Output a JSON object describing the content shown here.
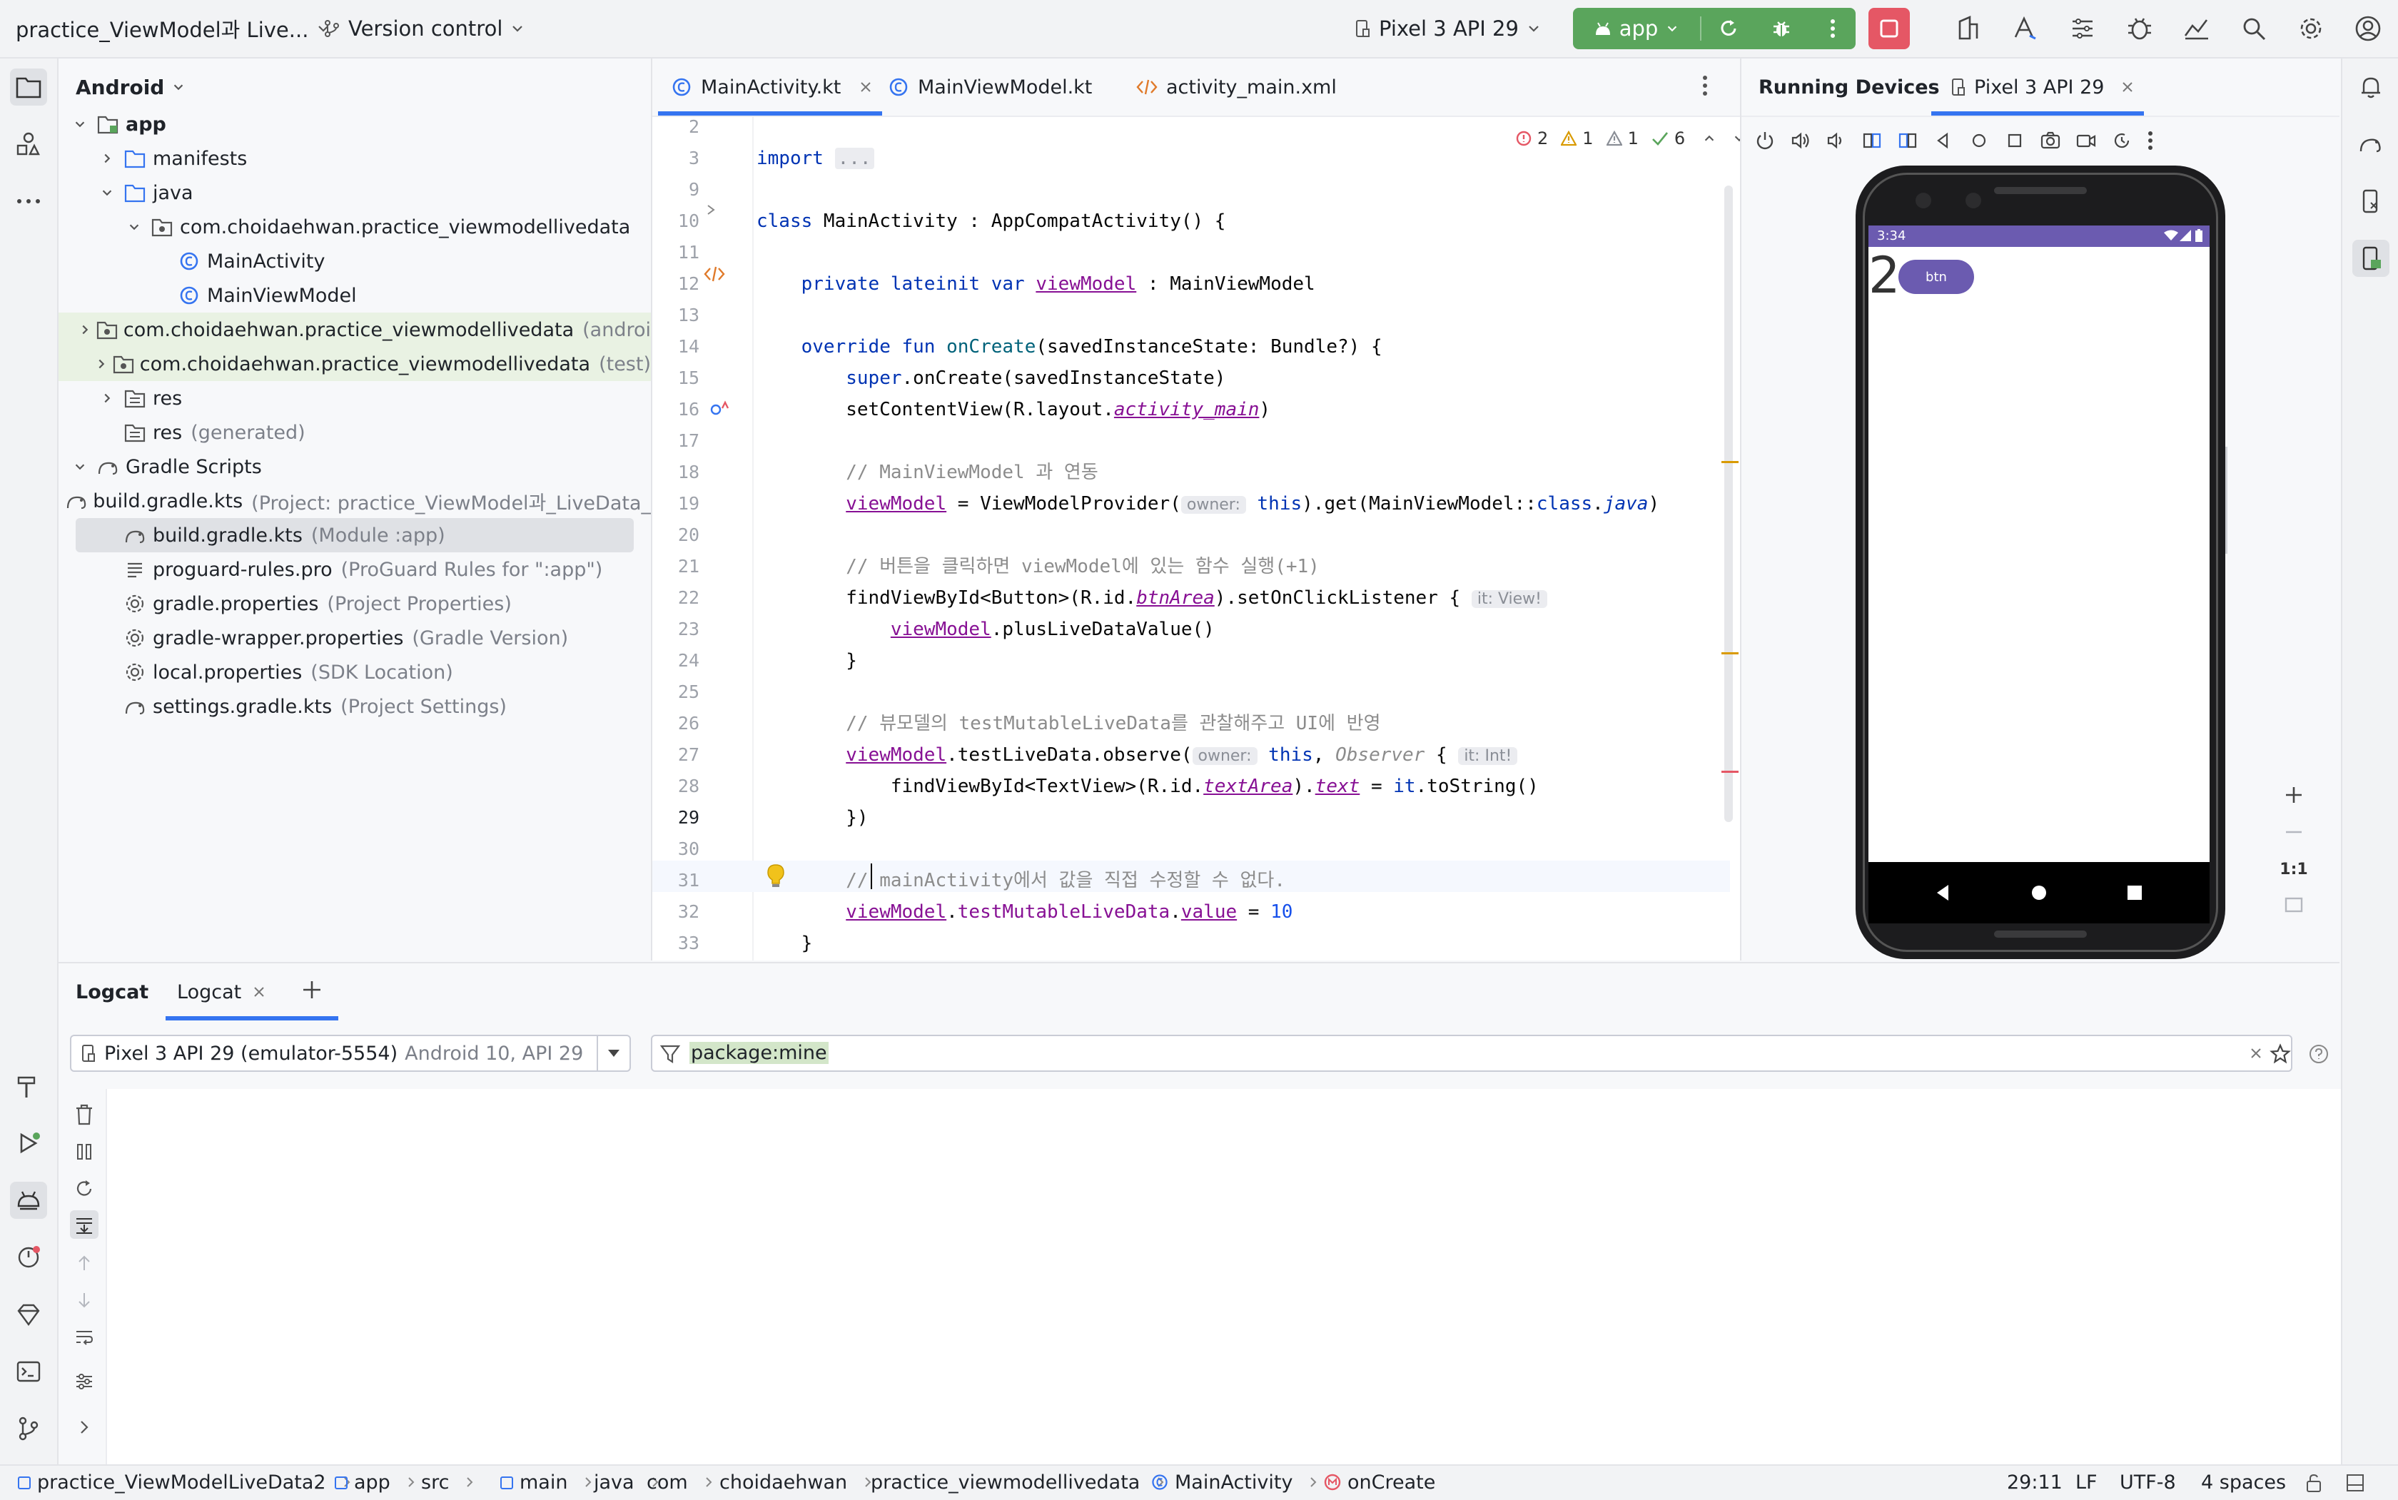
{
  "titlebar": {
    "project_name": "practice_ViewModel과 Live...",
    "vcs_label": "Version control",
    "device_label": "Pixel 3 API 29",
    "run_config": "app"
  },
  "project_panel": {
    "view_mode": "Android",
    "items": [
      {
        "label": "app",
        "hint": ""
      },
      {
        "label": "manifests",
        "hint": ""
      },
      {
        "label": "java",
        "hint": ""
      },
      {
        "label": "com.choidaehwan.practice_viewmodellivedata",
        "hint": ""
      },
      {
        "label": "MainActivity",
        "hint": ""
      },
      {
        "label": "MainViewModel",
        "hint": ""
      },
      {
        "label": "com.choidaehwan.practice_viewmodellivedata",
        "hint": "(androi"
      },
      {
        "label": "com.choidaehwan.practice_viewmodellivedata",
        "hint": "(test)"
      },
      {
        "label": "res",
        "hint": ""
      },
      {
        "label": "res",
        "hint": "(generated)"
      },
      {
        "label": "Gradle Scripts",
        "hint": ""
      },
      {
        "label": "build.gradle.kts",
        "hint": "(Project: practice_ViewModel과_LiveData_"
      },
      {
        "label": "build.gradle.kts",
        "hint": "(Module :app)"
      },
      {
        "label": "proguard-rules.pro",
        "hint": "(ProGuard Rules for \":app\")"
      },
      {
        "label": "gradle.properties",
        "hint": "(Project Properties)"
      },
      {
        "label": "gradle-wrapper.properties",
        "hint": "(Gradle Version)"
      },
      {
        "label": "local.properties",
        "hint": "(SDK Location)"
      },
      {
        "label": "settings.gradle.kts",
        "hint": "(Project Settings)"
      }
    ]
  },
  "editor": {
    "tabs": [
      "MainActivity.kt",
      "MainViewModel.kt",
      "activity_main.xml"
    ],
    "inspections": {
      "errors": "2",
      "warnings": "1",
      "weak_warnings": "1",
      "ok": "6"
    },
    "line_numbers": [
      "2",
      "3",
      "9",
      "10",
      "11",
      "12",
      "13",
      "14",
      "15",
      "16",
      "17",
      "18",
      "19",
      "20",
      "21",
      "22",
      "23",
      "24",
      "25",
      "26",
      "27",
      "28",
      "29",
      "30",
      "31",
      "32",
      "33"
    ],
    "code": {
      "l3_import": "import",
      "l3_fold": "...",
      "l10_class": "class",
      "l10_name": "MainActivity",
      "l10_rest": " : AppCompatActivity() {",
      "l12_mods": "private lateinit var",
      "l12_prop": "viewModel",
      "l12_type": " : MainViewModel",
      "l14_mods": "override fun",
      "l14_fn": "onCreate",
      "l14_rest": "(savedInstanceState: Bundle?) {",
      "l15_super": "super",
      "l15_rest": ".onCreate(savedInstanceState)",
      "l16_a": "setContentView(R.layout.",
      "l16_b": "activity_main",
      "l16_c": ")",
      "l18_comment": "// MainViewModel 과 연동",
      "l19_prop": "viewModel",
      "l19_a": " = ViewModelProvider(",
      "l19_hint": "owner:",
      "l19_this": "this",
      "l19_b": ").get(MainViewModel::",
      "l19_class": "class",
      "l19_dot": ".",
      "l19_java": "java",
      "l19_c": ")",
      "l21_comment": "// 버튼을 클릭하면 viewModel에 있는 함수 실행(+1)",
      "l22_a": "findViewById<Button>(R.id.",
      "l22_id": "btnArea",
      "l22_b": ").setOnClickListener {",
      "l22_hint": "it: View!",
      "l23_prop": "viewModel",
      "l23_rest": ".plusLiveDataValue()",
      "l24": "}",
      "l26_comment": "// 뷰모델의 testMutableLiveData를 관찰해주고 UI에 반영",
      "l27_prop": "viewModel",
      "l27_a": ".testLiveData.observe(",
      "l27_hint": "owner:",
      "l27_this": "this",
      "l27_comma": ",",
      "l27_obs": "Observer",
      "l27_brace": "{",
      "l27_hint2": "it: Int!",
      "l28_a": "findViewById<TextView>(R.id.",
      "l28_id": "textArea",
      "l28_b": ").",
      "l28_text": "text",
      "l28_c": " = ",
      "l28_it": "it",
      "l28_d": ".toString()",
      "l29": "})",
      "l31_comment": "// mainActivity에서 값을 직접 수정할 수 없다.",
      "l32_prop": "viewModel",
      "l32_dot": ".",
      "l32_field": "testMutableLiveData",
      "l32_dot2": ".",
      "l32_value": "value",
      "l32_eq": " = ",
      "l32_num": "10",
      "l33": "}"
    }
  },
  "running_devices": {
    "title": "Running Devices",
    "device_tab": "Pixel 3 API 29",
    "phone_time": "3:34",
    "app_text": "2",
    "app_button": "btn",
    "zoom_label": "1:1"
  },
  "logcat": {
    "title": "Logcat",
    "tab": "Logcat",
    "device_name": "Pixel 3 API 29 (emulator-5554)",
    "device_detail": "Android 10, API 29",
    "filter": "package:mine"
  },
  "statusbar": {
    "crumbs": [
      "practice_ViewModelLiveData2",
      "app",
      "src",
      "main",
      "java",
      "com",
      "choidaehwan",
      "practice_viewmodellivedata",
      "MainActivity",
      "onCreate"
    ],
    "position": "29:11",
    "line_sep": "LF",
    "encoding": "UTF-8",
    "indent": "4 spaces"
  },
  "colors": {
    "run_green": "#5aa55c",
    "stop_red": "#e55765",
    "accent_blue": "#3574f0",
    "phone_purple": "#6b5bb0"
  }
}
